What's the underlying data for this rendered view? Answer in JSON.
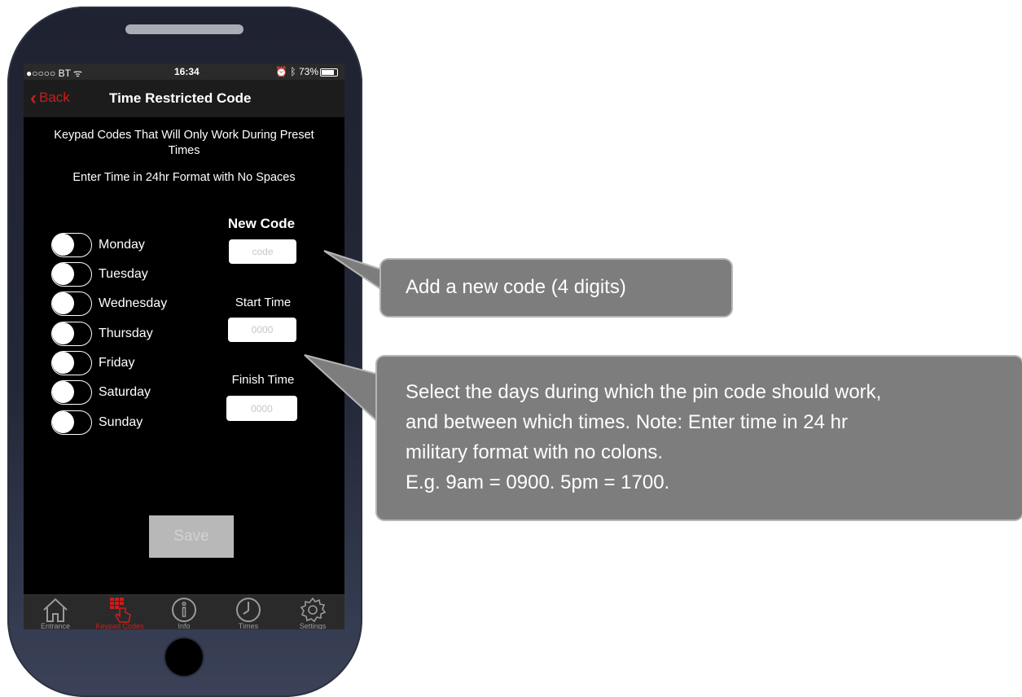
{
  "status_bar": {
    "carrier": "●○○○○ BT",
    "time": "16:34",
    "battery": "73%"
  },
  "nav": {
    "back_label": "Back",
    "title": "Time Restricted Code"
  },
  "instructions": {
    "line1": "Keypad Codes That Will Only Work During Preset Times",
    "line2": "Enter Time in 24hr Format with No Spaces"
  },
  "days": [
    {
      "label": "Monday",
      "on": false
    },
    {
      "label": "Tuesday",
      "on": false
    },
    {
      "label": "Wednesday",
      "on": false
    },
    {
      "label": "Thursday",
      "on": false
    },
    {
      "label": "Friday",
      "on": false
    },
    {
      "label": "Saturday",
      "on": false
    },
    {
      "label": "Sunday",
      "on": false
    }
  ],
  "form": {
    "new_code_label": "New Code",
    "code_placeholder": "code",
    "start_time_label": "Start Time",
    "start_placeholder": "0000",
    "finish_time_label": "Finish Time",
    "finish_placeholder": "0000",
    "save_label": "Save"
  },
  "tabs": [
    {
      "label": "Entrance",
      "icon": "house-icon",
      "active": false
    },
    {
      "label": "Keypad Codes",
      "icon": "keypad-icon",
      "active": true
    },
    {
      "label": "Info",
      "icon": "info-icon",
      "active": false
    },
    {
      "label": "Times",
      "icon": "clock-icon",
      "active": false
    },
    {
      "label": "Settings",
      "icon": "gear-icon",
      "active": false
    }
  ],
  "callouts": {
    "add_code": "Add a new code (4 digits)",
    "select_days": "Select the days during which the pin code should work,\nand between which times. Note: Enter time in 24 hr\nmilitary format with no colons.\n E.g. 9am = 0900. 5pm = 1700."
  },
  "colors": {
    "accent_red": "#c61f1f",
    "callout_gray": "#7d7d7d"
  }
}
